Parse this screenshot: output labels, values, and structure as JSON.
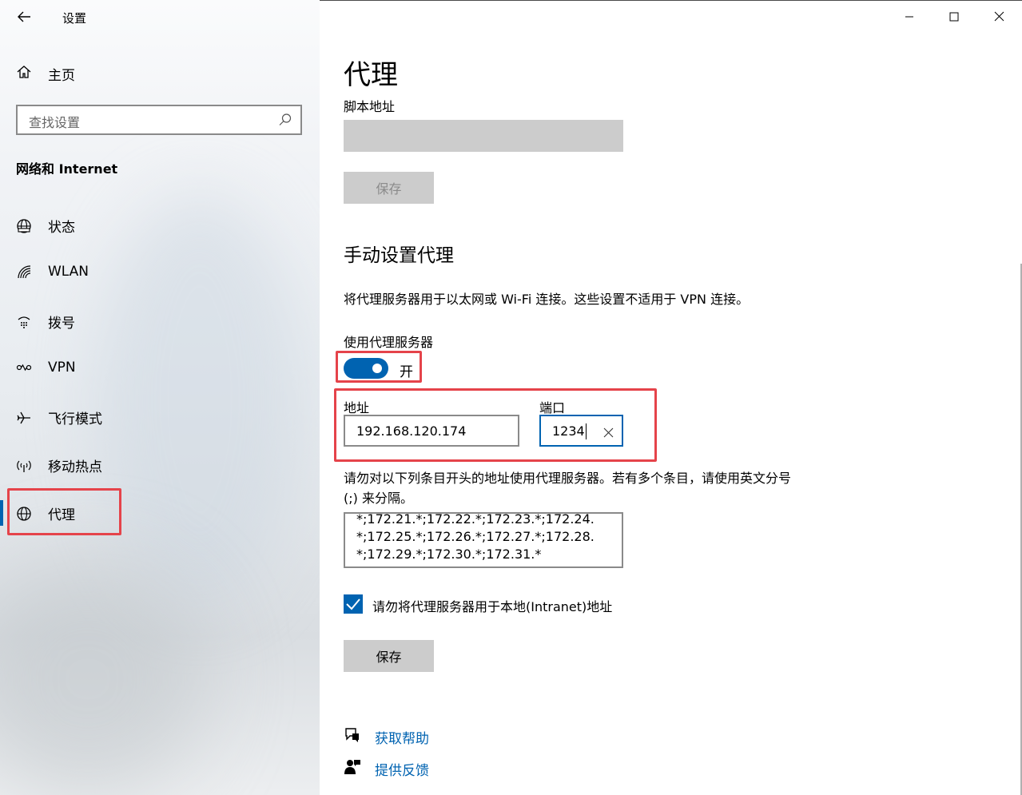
{
  "app": {
    "title": "设置"
  },
  "sidebar": {
    "home": "主页",
    "search_placeholder": "查找设置",
    "section": "网络和 Internet",
    "items": [
      {
        "label": "状态",
        "icon": "globe-status-icon"
      },
      {
        "label": "WLAN",
        "icon": "wifi-icon"
      },
      {
        "label": "拨号",
        "icon": "dialup-icon"
      },
      {
        "label": "VPN",
        "icon": "vpn-icon"
      },
      {
        "label": "飞行模式",
        "icon": "airplane-icon"
      },
      {
        "label": "移动热点",
        "icon": "hotspot-icon"
      },
      {
        "label": "代理",
        "icon": "globe-icon",
        "selected": true
      }
    ]
  },
  "main": {
    "title": "代理",
    "script_label": "脚本地址",
    "save_disabled": "保存",
    "manual_heading": "手动设置代理",
    "manual_desc": "将代理服务器用于以太网或 Wi-Fi 连接。这些设置不适用于 VPN 连接。",
    "use_proxy_label": "使用代理服务器",
    "toggle_state": "开",
    "toggle_on": true,
    "address_label": "地址",
    "address_value": "192.168.120.174",
    "port_label": "端口",
    "port_value": "1234",
    "exceptions_label": "请勿对以下列条目开头的地址使用代理服务器。若有多个条目，请使用英文分号 (;) 来分隔。",
    "exceptions_value": "*;172.21.*;172.22.*;172.23.*;172.24.*;172.25.*;172.26.*;172.27.*;172.28.*;172.29.*;172.30.*;172.31.*",
    "local_checkbox_label": "请勿将代理服务器用于本地(Intranet)地址",
    "local_checked": true,
    "save": "保存",
    "help": "获取帮助",
    "feedback": "提供反馈"
  },
  "colors": {
    "accent": "#0063b1",
    "highlight": "#e5434a"
  }
}
